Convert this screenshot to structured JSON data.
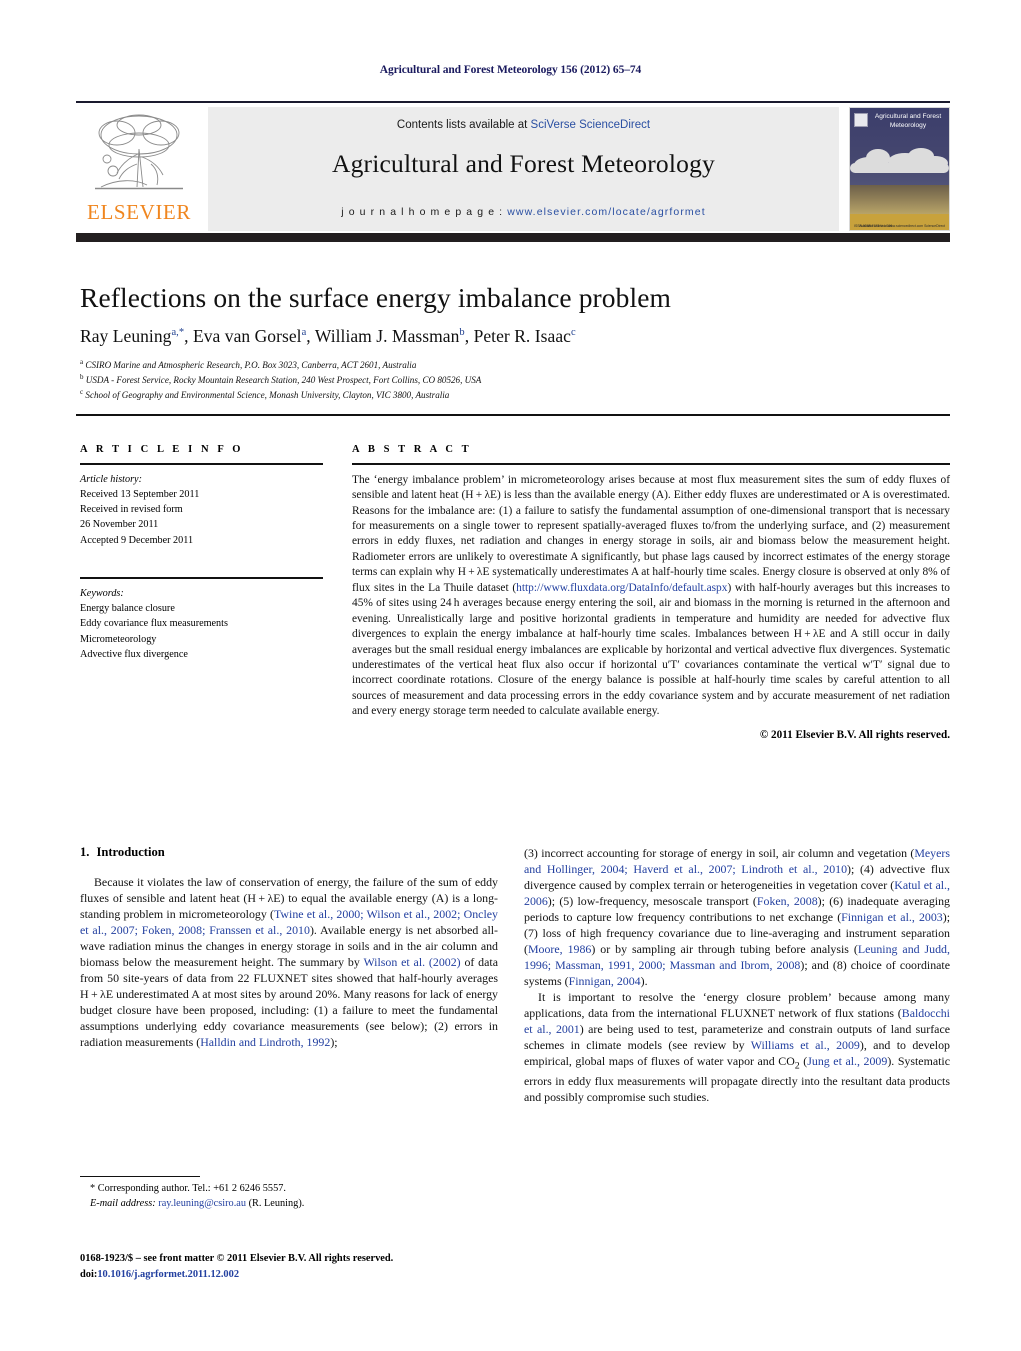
{
  "running_head": "Agricultural and Forest Meteorology 156 (2012) 65–74",
  "masthead": {
    "publisher_name": "ELSEVIER",
    "contents_prefix": "Contents lists available at ",
    "contents_link": "SciVerse ScienceDirect",
    "journal_name": "Agricultural and Forest Meteorology",
    "homepage_label": "j o u r n a l  h o m e p a g e :  ",
    "homepage_url": "www.elsevier.com/locate/agrformet",
    "cover_title": "Agricultural and Forest Meteorology",
    "cover_footer_left": "ISSN 0168-1923\nVol. 156",
    "cover_footer_right": "Available online at\nwww.sciencedirect.com\nScienceDirect"
  },
  "article": {
    "title": "Reflections on the surface energy imbalance problem",
    "authors": [
      {
        "name": "Ray Leuning",
        "marks": "a,*"
      },
      {
        "name": "Eva van Gorsel",
        "marks": "a"
      },
      {
        "name": "William J. Massman",
        "marks": "b"
      },
      {
        "name": "Peter R. Isaac",
        "marks": "c"
      }
    ],
    "affiliations": [
      {
        "mark": "a",
        "text": "CSIRO Marine and Atmospheric Research, P.O. Box 3023, Canberra, ACT 2601, Australia"
      },
      {
        "mark": "b",
        "text": "USDA - Forest Service, Rocky Mountain Research Station, 240 West Prospect, Fort Collins, CO 80526, USA"
      },
      {
        "mark": "c",
        "text": "School of Geography and Environmental Science, Monash University, Clayton, VIC 3800, Australia"
      }
    ]
  },
  "article_info": {
    "heading": "A R T I C L E   I N F O",
    "history_label": "Article history:",
    "history": [
      "Received 13 September 2011",
      "Received in revised form",
      "26 November 2011",
      "Accepted 9 December 2011"
    ],
    "keywords_label": "Keywords:",
    "keywords": [
      "Energy balance closure",
      "Eddy covariance flux measurements",
      "Micrometeorology",
      "Advective flux divergence"
    ]
  },
  "abstract": {
    "heading": "A B S T R A C T",
    "paragraph_1": "The ‘energy imbalance problem’ in micrometeorology arises because at most flux measurement sites the sum of eddy fluxes of sensible and latent heat (H + λE) is less than the available energy (A). Either eddy fluxes are underestimated or A is overestimated. Reasons for the imbalance are: (1) a failure to satisfy the fundamental assumption of one-dimensional transport that is necessary for measurements on a single tower to represent spatially-averaged fluxes to/from the underlying surface, and (2) measurement errors in eddy fluxes, net radiation and changes in energy storage in soils, air and biomass below the measurement height. Radiometer errors are unlikely to overestimate A significantly, but phase lags caused by incorrect estimates of the energy storage terms can explain why H + λE systematically underestimates A at half-hourly time scales. Energy closure is observed at only 8% of flux sites in the La Thuile dataset (",
    "link_url": "http://www.fluxdata.org/DataInfo/default.aspx",
    "paragraph_2": ") with half-hourly averages but this increases to 45% of sites using 24 h averages because energy entering the soil, air and biomass in the morning is returned in the afternoon and evening. Unrealistically large and positive horizontal gradients in temperature and humidity are needed for advective flux divergences to explain the energy imbalance at half-hourly time scales. Imbalances between H + λE and A still occur in daily averages but the small residual energy imbalances are explicable by horizontal and vertical advective flux divergences. Systematic underestimates of the vertical heat flux also occur if horizontal u′T′ covariances contaminate the vertical w′T′ signal due to incorrect coordinate rotations. Closure of the energy balance is possible at half-hourly time scales by careful attention to all sources of measurement and data processing errors in the eddy covariance system and by accurate measurement of net radiation and every energy storage term needed to calculate available energy.",
    "copyright": "© 2011 Elsevier B.V. All rights reserved."
  },
  "introduction": {
    "number": "1.",
    "heading": "Introduction",
    "p1_a": "Because it violates the law of conservation of energy, the failure of the sum of eddy fluxes of sensible and latent heat (H + λE) to equal the available energy (A) is a long-standing problem in micrometeorology (",
    "p1_cite1": "Twine et al., 2000; Wilson et al., 2002; Oncley et al., 2007; Foken, 2008; Franssen et al., 2010",
    "p1_b": "). Available energy is net absorbed all-wave radiation minus the changes in energy storage in soils and in the air column and biomass below the measurement height. The summary by ",
    "p1_cite2": "Wilson et al. (2002)",
    "p1_c": " of data from 50 site-years of data from 22 FLUXNET sites showed that half-hourly averages H + λE underestimated A at most sites by around 20%. Many reasons for lack of energy budget closure have been proposed, including: (1) a failure to meet the fundamental assumptions underlying eddy covariance measurements (see below); (2) errors in radiation measurements (",
    "p1_cite3": "Halldin and Lindroth, 1992",
    "p1_d": ");",
    "p2_a": "(3) incorrect accounting for storage of energy in soil, air column and vegetation (",
    "p2_cite1": "Meyers and Hollinger, 2004; Haverd et al., 2007; Lindroth et al., 2010",
    "p2_b": "); (4) advective flux divergence caused by complex terrain or heterogeneities in vegetation cover (",
    "p2_cite2": "Katul et al., 2006",
    "p2_c": "); (5) low-frequency, mesoscale transport (",
    "p2_cite3": "Foken, 2008",
    "p2_d": "); (6) inadequate averaging periods to capture low frequency contributions to net exchange (",
    "p2_cite4": "Finnigan et al., 2003",
    "p2_e": "); (7) loss of high frequency covariance due to line-averaging and instrument separation (",
    "p2_cite5": "Moore, 1986",
    "p2_f": ") or by sampling air through tubing before analysis (",
    "p2_cite6": "Leuning and Judd, 1996; Massman, 1991, 2000; Massman and Ibrom, 2008",
    "p2_g": "); and (8) choice of coordinate systems (",
    "p2_cite7": "Finnigan, 2004",
    "p2_h": ").",
    "p3_a": "It is important to resolve the ‘energy closure problem’ because among many applications, data from the international FLUXNET network of flux stations (",
    "p3_cite1": "Baldocchi et al., 2001",
    "p3_b": ") are being used to test, parameterize and constrain outputs of land surface schemes in climate models (see review by ",
    "p3_cite2": "Williams et al., 2009",
    "p3_c": "), and to develop empirical, global maps of fluxes of water vapor and CO",
    "p3_sub": "2",
    "p3_d": " (",
    "p3_cite3": "Jung et al., 2009",
    "p3_e": "). Systematic errors in eddy flux measurements will propagate directly into the resultant data products and possibly compromise such studies."
  },
  "footnotes": {
    "corresponding": "* Corresponding author. Tel.: +61 2 6246 5557.",
    "email_label": "E-mail address:",
    "email": "ray.leuning@csiro.au",
    "email_suffix": " (R. Leuning).",
    "issn_line": "0168-1923/$ – see front matter © 2011 Elsevier B.V. All rights reserved.",
    "doi_label": "doi:",
    "doi": "10.1016/j.agrformet.2011.12.002"
  },
  "colors": {
    "link": "#2340a0",
    "elsevier_orange": "#f0861f",
    "rule_dark": "#231f20",
    "running_head": "#1a1a5e"
  }
}
